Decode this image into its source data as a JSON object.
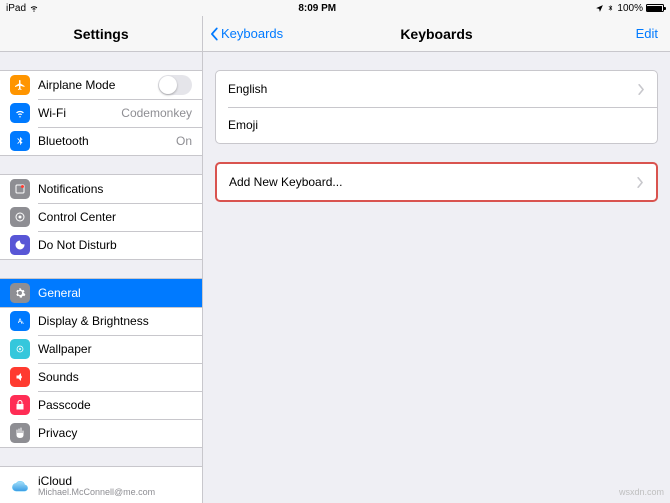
{
  "status": {
    "device": "iPad",
    "time": "8:09 PM",
    "battery": "100%"
  },
  "sidebar": {
    "title": "Settings",
    "groups": [
      {
        "rows": [
          {
            "label": "Airplane Mode"
          },
          {
            "label": "Wi-Fi",
            "value": "Codemonkey"
          },
          {
            "label": "Bluetooth",
            "value": "On"
          }
        ]
      },
      {
        "rows": [
          {
            "label": "Notifications"
          },
          {
            "label": "Control Center"
          },
          {
            "label": "Do Not Disturb"
          }
        ]
      },
      {
        "rows": [
          {
            "label": "General"
          },
          {
            "label": "Display & Brightness"
          },
          {
            "label": "Wallpaper"
          },
          {
            "label": "Sounds"
          },
          {
            "label": "Passcode"
          },
          {
            "label": "Privacy"
          }
        ]
      },
      {
        "rows": [
          {
            "label": "iCloud",
            "sub": "Michael.McConnell@me.com"
          }
        ]
      }
    ]
  },
  "main": {
    "back": "Keyboards",
    "title": "Keyboards",
    "edit": "Edit",
    "groups": [
      {
        "rows": [
          {
            "label": "English",
            "chevron": true
          },
          {
            "label": "Emoji"
          }
        ]
      },
      {
        "highlight": true,
        "rows": [
          {
            "label": "Add New Keyboard...",
            "chevron": true
          }
        ]
      }
    ]
  },
  "watermark": "wsxdn.com"
}
